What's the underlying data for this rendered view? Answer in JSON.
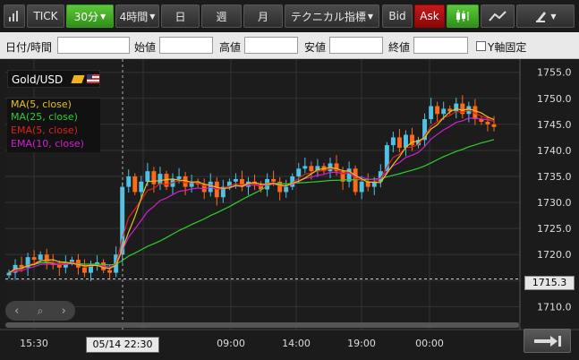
{
  "toolbar": {
    "tick": "TICK",
    "interval": "30分",
    "range": "4時間",
    "day": "日",
    "week": "週",
    "month": "月",
    "tech": "テクニカル指標",
    "bid": "Bid",
    "ask": "Ask"
  },
  "fields": {
    "datetime": "日付/時間",
    "open": "始値",
    "high": "高値",
    "low": "安値",
    "close": "終値",
    "yfix": "Y軸固定"
  },
  "symbol": "Gold/USD",
  "legend": [
    "MA(5, close)",
    "MA(25, close)",
    "EMA(5, close)",
    "EMA(10, close)"
  ],
  "colors": {
    "ma5": "#e8c020",
    "ma25": "#33cc33",
    "ema5": "#e02020",
    "ema10": "#d020d0",
    "up": "#4ec3e8",
    "down": "#ff6a1a",
    "grid": "#333333"
  },
  "y_ticks": [
    "1755.0",
    "1750.0",
    "1745.0",
    "1740.0",
    "1735.0",
    "1730.0",
    "1725.0",
    "1720.0",
    "1715.0",
    "1710.0"
  ],
  "x_ticks": [
    "15:30",
    "22:30",
    "09:00",
    "14:00",
    "19:00",
    "00:00"
  ],
  "price_label": "1715.3",
  "cursor_date": "05/14 22:30"
}
